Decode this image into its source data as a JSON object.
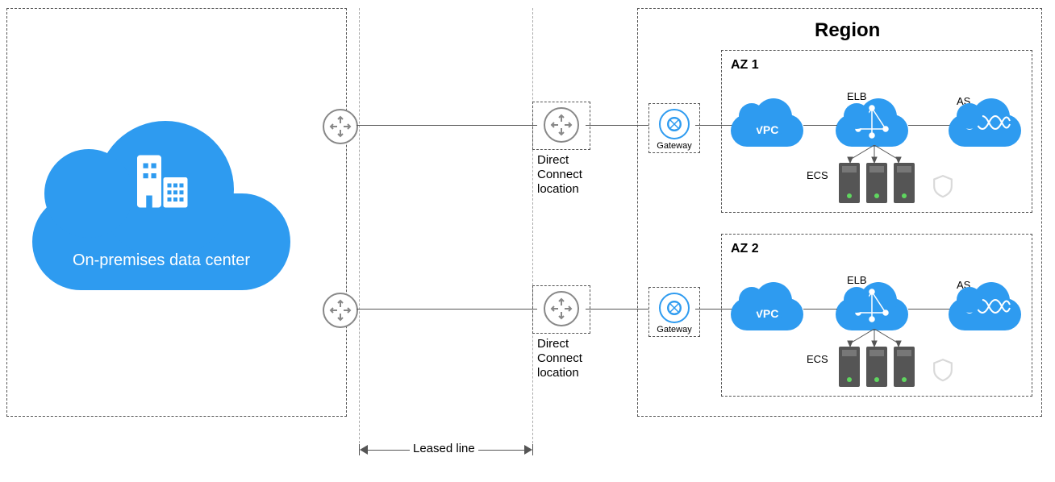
{
  "onprem": {
    "title": "On-premises data center"
  },
  "leased_line": "Leased line",
  "dc1": {
    "label_l1": "Direct",
    "label_l2": "Connect",
    "label_l3": "location"
  },
  "dc2": {
    "label_l1": "Direct",
    "label_l2": "Connect",
    "label_l3": "location"
  },
  "gw1": {
    "label": "Gateway"
  },
  "gw2": {
    "label": "Gateway"
  },
  "region": {
    "title": "Region"
  },
  "az1": {
    "title": "AZ 1",
    "vpc": "VPC",
    "elb": "ELB",
    "ecs": "ECS",
    "as": "AS"
  },
  "az2": {
    "title": "AZ 2",
    "vpc": "VPC",
    "elb": "ELB",
    "ecs": "ECS",
    "as": "AS"
  },
  "colors": {
    "primary": "#2e9bf0",
    "server": "#555555"
  }
}
